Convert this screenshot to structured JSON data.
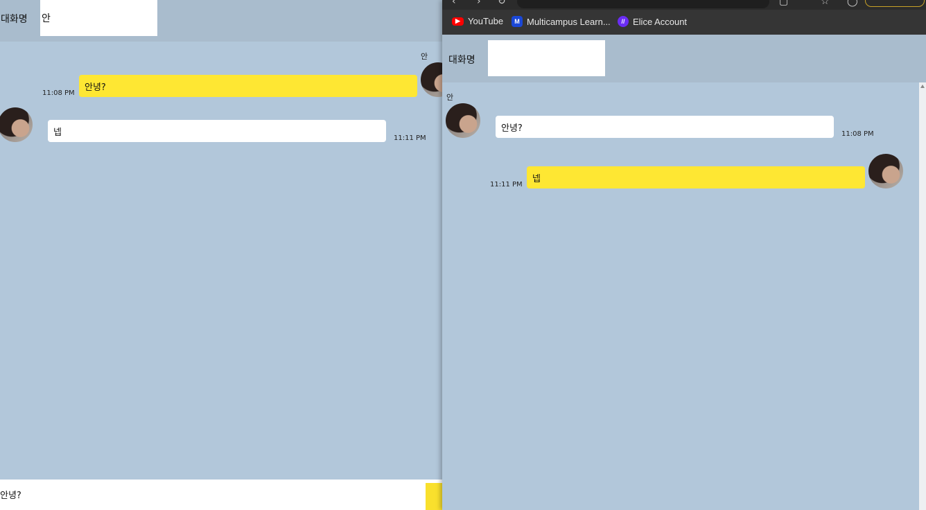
{
  "left_window": {
    "room_label": "대화명",
    "room_name_value": "안",
    "messages": [
      {
        "sender": "안",
        "text": "안녕?",
        "time": "11:08 PM"
      },
      {
        "text": "넵",
        "time": "11:11 PM"
      }
    ],
    "message_input_value": "안녕?"
  },
  "right_window": {
    "bookmarks": [
      {
        "label": "YouTube",
        "icon": "youtube-icon",
        "color": "#ff0000"
      },
      {
        "label": "Multicampus Learn...",
        "icon": "multicampus-icon",
        "color": "#1a47d6"
      },
      {
        "label": "Elice Account",
        "icon": "elice-icon",
        "color": "#6a2cf5"
      }
    ],
    "room_label": "대화명",
    "room_name_value": "",
    "messages": [
      {
        "sender": "안",
        "text": "안녕?",
        "time": "11:08 PM"
      },
      {
        "text": "넵",
        "time": "11:11 PM"
      }
    ]
  },
  "colors": {
    "chat_background": "#b2c7da",
    "header_background": "#a9bccd",
    "my_bubble": "#fee733",
    "their_bubble": "#ffffff"
  }
}
